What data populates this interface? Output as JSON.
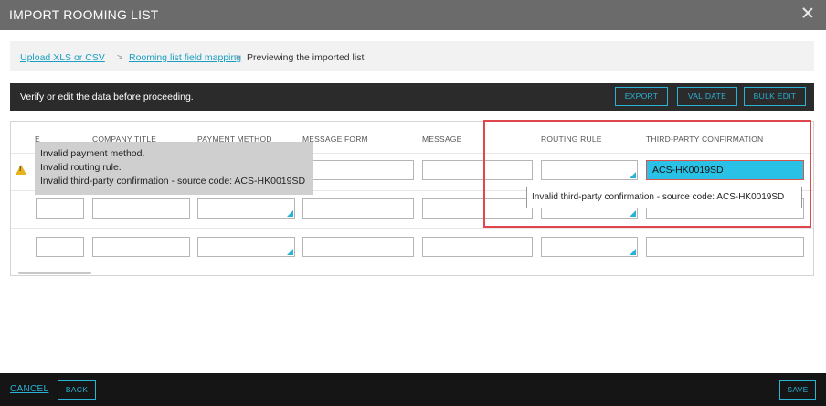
{
  "dialog": {
    "title": "IMPORT ROOMING LIST"
  },
  "breadcrumb": {
    "step1": "Upload XLS or CSV",
    "step2": "Rooming list field mapping",
    "current": "Previewing the imported list",
    "separator": ">"
  },
  "banner": {
    "message": "Verify or edit the data before proceeding.",
    "export_label": "EXPORT",
    "validate_label": "VALIDATE",
    "bulk_edit_label": "BULK EDIT"
  },
  "table": {
    "headers": [
      "E",
      "COMPANY TITLE",
      "PAYMENT METHOD",
      "MESSAGE FORM",
      "MESSAGE",
      "ROUTING RULE",
      "THIRD-PARTY CONFIRMATION"
    ],
    "row1_third_party": "ACS-HK0019SD"
  },
  "tooltips": {
    "row_errors": {
      "line1": "Invalid payment method.",
      "line2": "Invalid routing rule.",
      "line3": "Invalid third-party confirmation - source code: ACS-HK0019SD"
    },
    "cell_error": "Invalid third-party confirmation - source code: ACS-HK0019SD"
  },
  "icons": {
    "close": "close-icon",
    "warning": "warning-icon",
    "dropdown": "dropdown-corner-icon"
  },
  "colors": {
    "accent": "#2bb3d6",
    "error": "#e0474c",
    "warning": "#e8b31a"
  },
  "footer": {
    "cancel_label": "CANCEL",
    "back_label": "BACK",
    "save_label": "SAVE"
  }
}
